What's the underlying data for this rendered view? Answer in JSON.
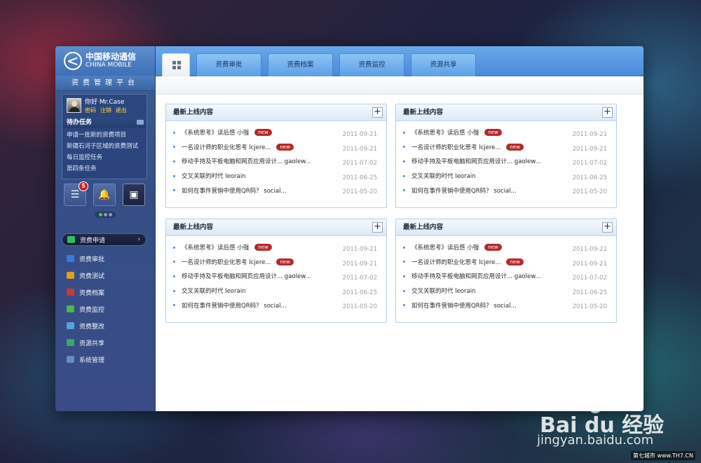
{
  "brand": {
    "logo_cn": "中国移动通信",
    "logo_en": "CHINA MOBILE",
    "platform": "资费管理平台"
  },
  "user": {
    "greeting": "你好 Mr.Case",
    "links": [
      "密码",
      "注销",
      "退出"
    ]
  },
  "todo": {
    "title": "待办任务",
    "items": [
      "申请一批新的资费项目",
      "新疆石河子区域的资费测试",
      "每日监控任务",
      "第四条任务"
    ]
  },
  "quick": {
    "badge_count": "5"
  },
  "menu": [
    {
      "label": "资费申请",
      "color": "#38b860"
    },
    {
      "label": "资费审批",
      "color": "#3a7ad8"
    },
    {
      "label": "资费测试",
      "color": "#e0a020"
    },
    {
      "label": "资费档案",
      "color": "#c83a3a"
    },
    {
      "label": "资费监控",
      "color": "#4ab84a"
    },
    {
      "label": "资费整改",
      "color": "#5aa0e0"
    },
    {
      "label": "资源共享",
      "color": "#3aa86a"
    },
    {
      "label": "系统管理",
      "color": "#6a8ac8"
    }
  ],
  "tabs": [
    "资费审批",
    "资费档案",
    "资费监控",
    "资源共享"
  ],
  "panels": [
    {
      "title": "最新上线内容"
    },
    {
      "title": "最新上线内容"
    },
    {
      "title": "最新上线内容"
    },
    {
      "title": "最新上线内容"
    }
  ],
  "rows": [
    {
      "text": "《系统思考》读后感 小强",
      "tag": "new",
      "date": "2011-09-21"
    },
    {
      "text": "一名设计师的职业化思考 lcjere...",
      "tag": "new",
      "date": "2011-09-21"
    },
    {
      "text": "移动手持及平板电脑和网页应用设计... gaolew...",
      "tag": "",
      "date": "2011-07-02"
    },
    {
      "text": "交叉关联的时代 leorain",
      "tag": "",
      "date": "2011-06-25"
    },
    {
      "text": "如何在事件营销中使用QR码？ social...",
      "tag": "",
      "date": "2011-05-20"
    }
  ],
  "watermark": {
    "line1": "Bai du 经验",
    "line2": "jingyan.baidu.com",
    "corner": "第七城市 www.TH7.CN"
  }
}
